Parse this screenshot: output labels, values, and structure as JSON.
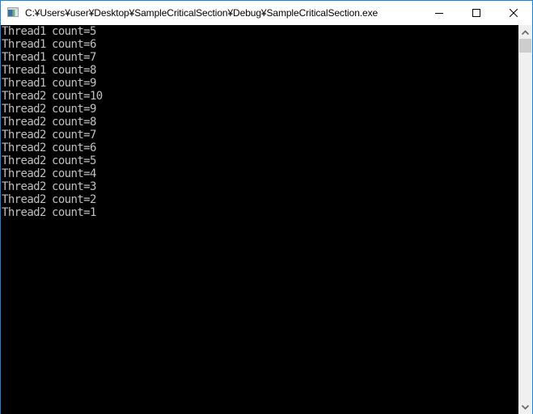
{
  "window": {
    "title": "C:¥Users¥user¥Desktop¥SampleCriticalSection¥Debug¥SampleCriticalSection.exe",
    "app_icon": "console-app-icon",
    "controls": {
      "minimize_icon": "minimize-icon",
      "maximize_icon": "maximize-icon",
      "close_icon": "close-icon"
    },
    "accent_color": "#1883d7"
  },
  "console": {
    "background_color": "#000000",
    "text_color": "#c0c0c0",
    "lines": [
      {
        "thread": "Thread1",
        "count": "count=5"
      },
      {
        "thread": "Thread1",
        "count": "count=6"
      },
      {
        "thread": "Thread1",
        "count": "count=7"
      },
      {
        "thread": "Thread1",
        "count": "count=8"
      },
      {
        "thread": "Thread1",
        "count": "count=9"
      },
      {
        "thread": "Thread2",
        "count": "count=10"
      },
      {
        "thread": "Thread2",
        "count": "count=9"
      },
      {
        "thread": "Thread2",
        "count": "count=8"
      },
      {
        "thread": "Thread2",
        "count": "count=7"
      },
      {
        "thread": "Thread2",
        "count": "count=6"
      },
      {
        "thread": "Thread2",
        "count": "count=5"
      },
      {
        "thread": "Thread2",
        "count": "count=4"
      },
      {
        "thread": "Thread2",
        "count": "count=3"
      },
      {
        "thread": "Thread2",
        "count": "count=2"
      },
      {
        "thread": "Thread2",
        "count": "count=1"
      }
    ]
  },
  "scrollbar": {
    "up_icon": "chevron-up-icon",
    "down_icon": "chevron-down-icon",
    "scroll_position": 0
  }
}
